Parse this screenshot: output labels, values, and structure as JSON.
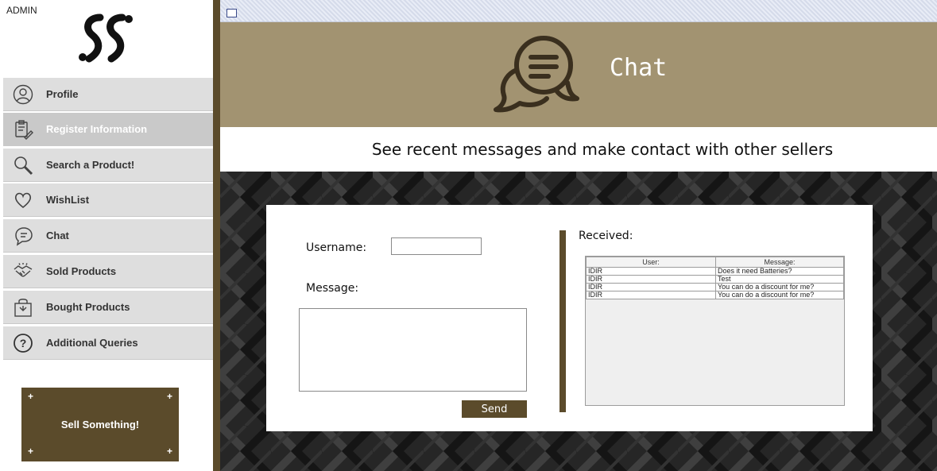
{
  "sidebar": {
    "admin_label": "ADMIN",
    "logo_icon": "ss-logo-icon",
    "items": [
      {
        "label": "Profile",
        "icon": "user-icon"
      },
      {
        "label": "Register Information",
        "icon": "clipboard-pen-icon",
        "active": true
      },
      {
        "label": "Search a Product!",
        "icon": "search-icon"
      },
      {
        "label": "WishList",
        "icon": "heart-icon"
      },
      {
        "label": "Chat",
        "icon": "chat-bubble-icon"
      },
      {
        "label": "Sold Products",
        "icon": "handshake-icon"
      },
      {
        "label": "Bought Products",
        "icon": "shopping-bag-icon"
      },
      {
        "label": "Additional Queries",
        "icon": "question-icon"
      }
    ],
    "sell_button": "Sell Something!"
  },
  "header": {
    "title": "Chat",
    "icon": "chat-bubbles-icon",
    "subtitle": "See recent messages and make contact with other sellers"
  },
  "chat_form": {
    "username_label": "Username:",
    "username_value": "",
    "message_label": "Message:",
    "message_value": "",
    "send_label": "Send"
  },
  "received": {
    "label": "Received:",
    "columns": [
      "User:",
      "Message:"
    ],
    "rows": [
      [
        "IDIR",
        "Does it need Batteries?"
      ],
      [
        "IDIR",
        "Test"
      ],
      [
        "IDIR",
        "You can do a discount for me?"
      ],
      [
        "IDIR",
        "You can do a discount for me?"
      ]
    ]
  },
  "colors": {
    "accent_dark": "#5b4b2b",
    "header_bg": "#a29371",
    "nav_bg": "#dedede",
    "pattern_bg": "#262626"
  }
}
